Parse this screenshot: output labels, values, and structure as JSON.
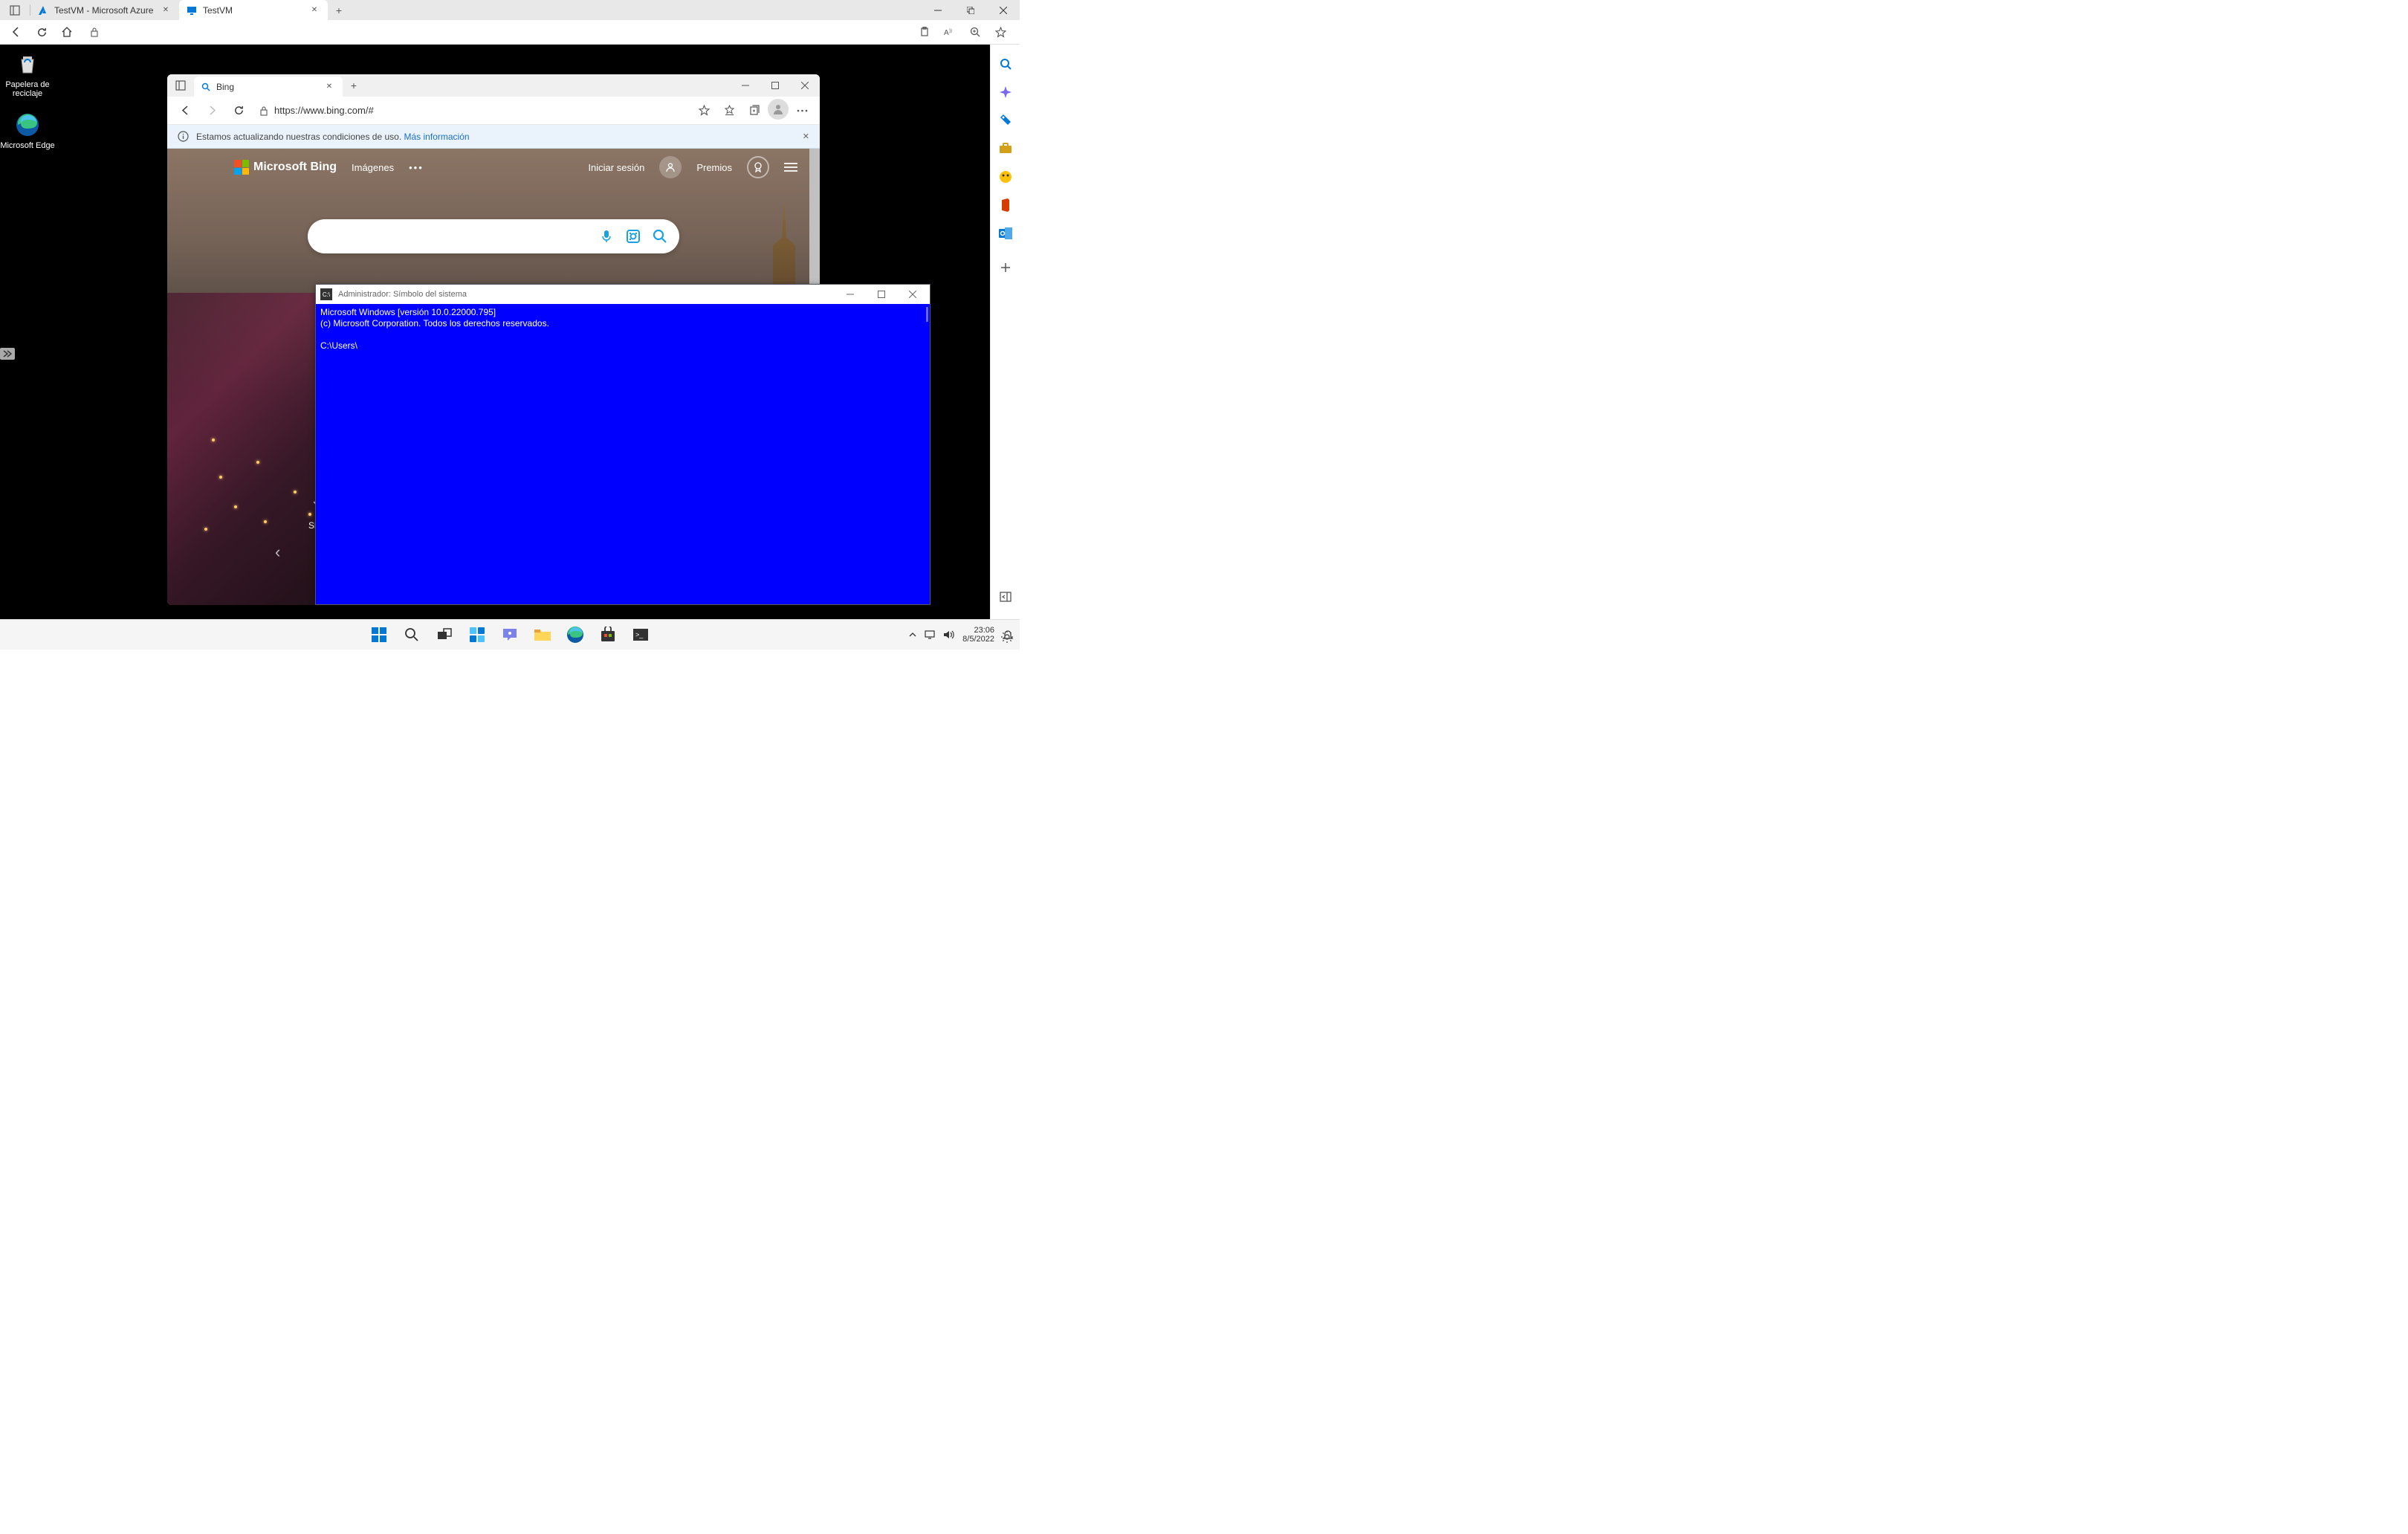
{
  "outer": {
    "tabs": [
      {
        "label": "TestVM  - Microsoft Azure",
        "active": false
      },
      {
        "label": "TestVM",
        "active": true
      }
    ],
    "window": {
      "minimize": "−",
      "maximize": "□",
      "close": "×"
    }
  },
  "sidebar_icons": [
    "search",
    "copilot",
    "tag",
    "briefcase",
    "games",
    "office",
    "outlook",
    "add",
    "collapse"
  ],
  "remote_desktop": {
    "icons": {
      "recycle": "Papelera de reciclaje",
      "edge": "Microsoft Edge"
    }
  },
  "inner_edge": {
    "tab_label": "Bing",
    "url": "https://www.bing.com/#",
    "infobar": {
      "text": "Estamos actualizando nuestras condiciones de uso.",
      "link": "Más información"
    },
    "bing": {
      "brand": "Microsoft Bing",
      "nav_images": "Imágenes",
      "signin": "Iniciar sesión",
      "rewards": "Premios",
      "show_label": "Sh"
    }
  },
  "cmd": {
    "title": "Administrador: Símbolo del sistema",
    "line1": "Microsoft Windows [versión 10.0.22000.795]",
    "line2": "(c) Microsoft Corporation. Todos los derechos reservados.",
    "prompt": "C:\\Users\\"
  },
  "tray": {
    "time": "23:06",
    "date": "8/5/2022"
  }
}
